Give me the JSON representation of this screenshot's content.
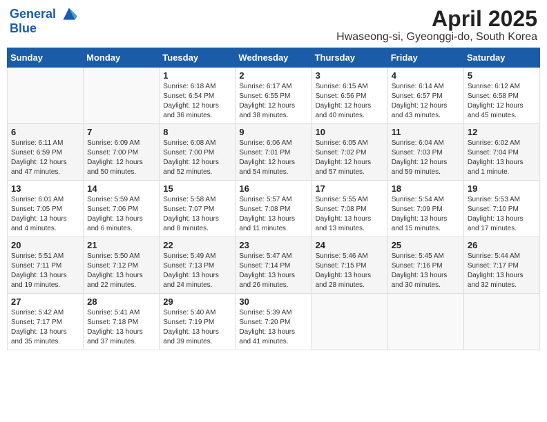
{
  "header": {
    "logo_line1": "General",
    "logo_line2": "Blue",
    "month_title": "April 2025",
    "location": "Hwaseong-si, Gyeonggi-do, South Korea"
  },
  "weekdays": [
    "Sunday",
    "Monday",
    "Tuesday",
    "Wednesday",
    "Thursday",
    "Friday",
    "Saturday"
  ],
  "weeks": [
    [
      {
        "day": "",
        "info": ""
      },
      {
        "day": "",
        "info": ""
      },
      {
        "day": "1",
        "info": "Sunrise: 6:18 AM\nSunset: 6:54 PM\nDaylight: 12 hours\nand 36 minutes."
      },
      {
        "day": "2",
        "info": "Sunrise: 6:17 AM\nSunset: 6:55 PM\nDaylight: 12 hours\nand 38 minutes."
      },
      {
        "day": "3",
        "info": "Sunrise: 6:15 AM\nSunset: 6:56 PM\nDaylight: 12 hours\nand 40 minutes."
      },
      {
        "day": "4",
        "info": "Sunrise: 6:14 AM\nSunset: 6:57 PM\nDaylight: 12 hours\nand 43 minutes."
      },
      {
        "day": "5",
        "info": "Sunrise: 6:12 AM\nSunset: 6:58 PM\nDaylight: 12 hours\nand 45 minutes."
      }
    ],
    [
      {
        "day": "6",
        "info": "Sunrise: 6:11 AM\nSunset: 6:59 PM\nDaylight: 12 hours\nand 47 minutes."
      },
      {
        "day": "7",
        "info": "Sunrise: 6:09 AM\nSunset: 7:00 PM\nDaylight: 12 hours\nand 50 minutes."
      },
      {
        "day": "8",
        "info": "Sunrise: 6:08 AM\nSunset: 7:00 PM\nDaylight: 12 hours\nand 52 minutes."
      },
      {
        "day": "9",
        "info": "Sunrise: 6:06 AM\nSunset: 7:01 PM\nDaylight: 12 hours\nand 54 minutes."
      },
      {
        "day": "10",
        "info": "Sunrise: 6:05 AM\nSunset: 7:02 PM\nDaylight: 12 hours\nand 57 minutes."
      },
      {
        "day": "11",
        "info": "Sunrise: 6:04 AM\nSunset: 7:03 PM\nDaylight: 12 hours\nand 59 minutes."
      },
      {
        "day": "12",
        "info": "Sunrise: 6:02 AM\nSunset: 7:04 PM\nDaylight: 13 hours\nand 1 minute."
      }
    ],
    [
      {
        "day": "13",
        "info": "Sunrise: 6:01 AM\nSunset: 7:05 PM\nDaylight: 13 hours\nand 4 minutes."
      },
      {
        "day": "14",
        "info": "Sunrise: 5:59 AM\nSunset: 7:06 PM\nDaylight: 13 hours\nand 6 minutes."
      },
      {
        "day": "15",
        "info": "Sunrise: 5:58 AM\nSunset: 7:07 PM\nDaylight: 13 hours\nand 8 minutes."
      },
      {
        "day": "16",
        "info": "Sunrise: 5:57 AM\nSunset: 7:08 PM\nDaylight: 13 hours\nand 11 minutes."
      },
      {
        "day": "17",
        "info": "Sunrise: 5:55 AM\nSunset: 7:08 PM\nDaylight: 13 hours\nand 13 minutes."
      },
      {
        "day": "18",
        "info": "Sunrise: 5:54 AM\nSunset: 7:09 PM\nDaylight: 13 hours\nand 15 minutes."
      },
      {
        "day": "19",
        "info": "Sunrise: 5:53 AM\nSunset: 7:10 PM\nDaylight: 13 hours\nand 17 minutes."
      }
    ],
    [
      {
        "day": "20",
        "info": "Sunrise: 5:51 AM\nSunset: 7:11 PM\nDaylight: 13 hours\nand 19 minutes."
      },
      {
        "day": "21",
        "info": "Sunrise: 5:50 AM\nSunset: 7:12 PM\nDaylight: 13 hours\nand 22 minutes."
      },
      {
        "day": "22",
        "info": "Sunrise: 5:49 AM\nSunset: 7:13 PM\nDaylight: 13 hours\nand 24 minutes."
      },
      {
        "day": "23",
        "info": "Sunrise: 5:47 AM\nSunset: 7:14 PM\nDaylight: 13 hours\nand 26 minutes."
      },
      {
        "day": "24",
        "info": "Sunrise: 5:46 AM\nSunset: 7:15 PM\nDaylight: 13 hours\nand 28 minutes."
      },
      {
        "day": "25",
        "info": "Sunrise: 5:45 AM\nSunset: 7:16 PM\nDaylight: 13 hours\nand 30 minutes."
      },
      {
        "day": "26",
        "info": "Sunrise: 5:44 AM\nSunset: 7:17 PM\nDaylight: 13 hours\nand 32 minutes."
      }
    ],
    [
      {
        "day": "27",
        "info": "Sunrise: 5:42 AM\nSunset: 7:17 PM\nDaylight: 13 hours\nand 35 minutes."
      },
      {
        "day": "28",
        "info": "Sunrise: 5:41 AM\nSunset: 7:18 PM\nDaylight: 13 hours\nand 37 minutes."
      },
      {
        "day": "29",
        "info": "Sunrise: 5:40 AM\nSunset: 7:19 PM\nDaylight: 13 hours\nand 39 minutes."
      },
      {
        "day": "30",
        "info": "Sunrise: 5:39 AM\nSunset: 7:20 PM\nDaylight: 13 hours\nand 41 minutes."
      },
      {
        "day": "",
        "info": ""
      },
      {
        "day": "",
        "info": ""
      },
      {
        "day": "",
        "info": ""
      }
    ]
  ]
}
